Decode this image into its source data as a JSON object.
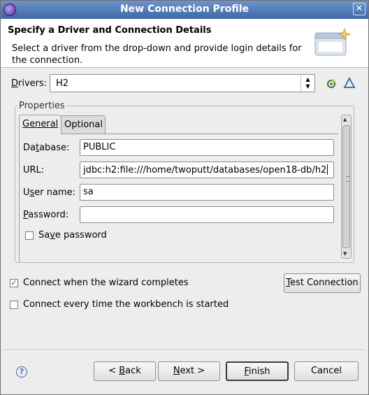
{
  "window": {
    "title": "New Connection Profile"
  },
  "banner": {
    "heading": "Specify a Driver and Connection Details",
    "description": "Select a driver from the drop-down and provide login details for the connection."
  },
  "drivers": {
    "label": "rivers:",
    "label_mnemonic": "D",
    "selected": "H2"
  },
  "properties": {
    "group_label": "Properties",
    "tabs": [
      {
        "label": "General",
        "active": true
      },
      {
        "label": "Optional",
        "active": false
      }
    ],
    "fields": {
      "database": {
        "label_pre": "Da",
        "label_mnemonic": "t",
        "label_post": "abase:",
        "value": "PUBLIC"
      },
      "url": {
        "label": "URL:",
        "value": "jdbc:h2:file:///home/twoputt/databases/open18-db/h2"
      },
      "username": {
        "label_pre": "U",
        "label_mnemonic": "s",
        "label_post": "er name:",
        "value": "sa"
      },
      "password": {
        "label_mnemonic": "P",
        "label_post": "assword:",
        "value": ""
      }
    },
    "save_password": {
      "label_pre": "Sa",
      "label_mnemonic": "v",
      "label_post": "e password",
      "checked": false
    }
  },
  "options": {
    "connect_when_complete": {
      "label": "Connect when the wizard completes",
      "checked": true
    },
    "connect_every_time": {
      "label": "Connect every time the workbench is started",
      "checked": false
    }
  },
  "buttons": {
    "test_connection_mnemonic": "T",
    "test_connection_rest": "est Connection",
    "back_pre": "< ",
    "back_mnemonic": "B",
    "back_post": "ack",
    "next_mnemonic": "N",
    "next_post": "ext >",
    "finish_mnemonic": "F",
    "finish_post": "inish",
    "cancel": "Cancel"
  },
  "icons": {
    "app": "eclipse-icon",
    "close": "close-icon",
    "banner": "database-connection-wizard-icon",
    "new_driver": "new-driver-icon",
    "edit_driver": "edit-driver-icon",
    "help": "help-icon",
    "check": "✓"
  }
}
